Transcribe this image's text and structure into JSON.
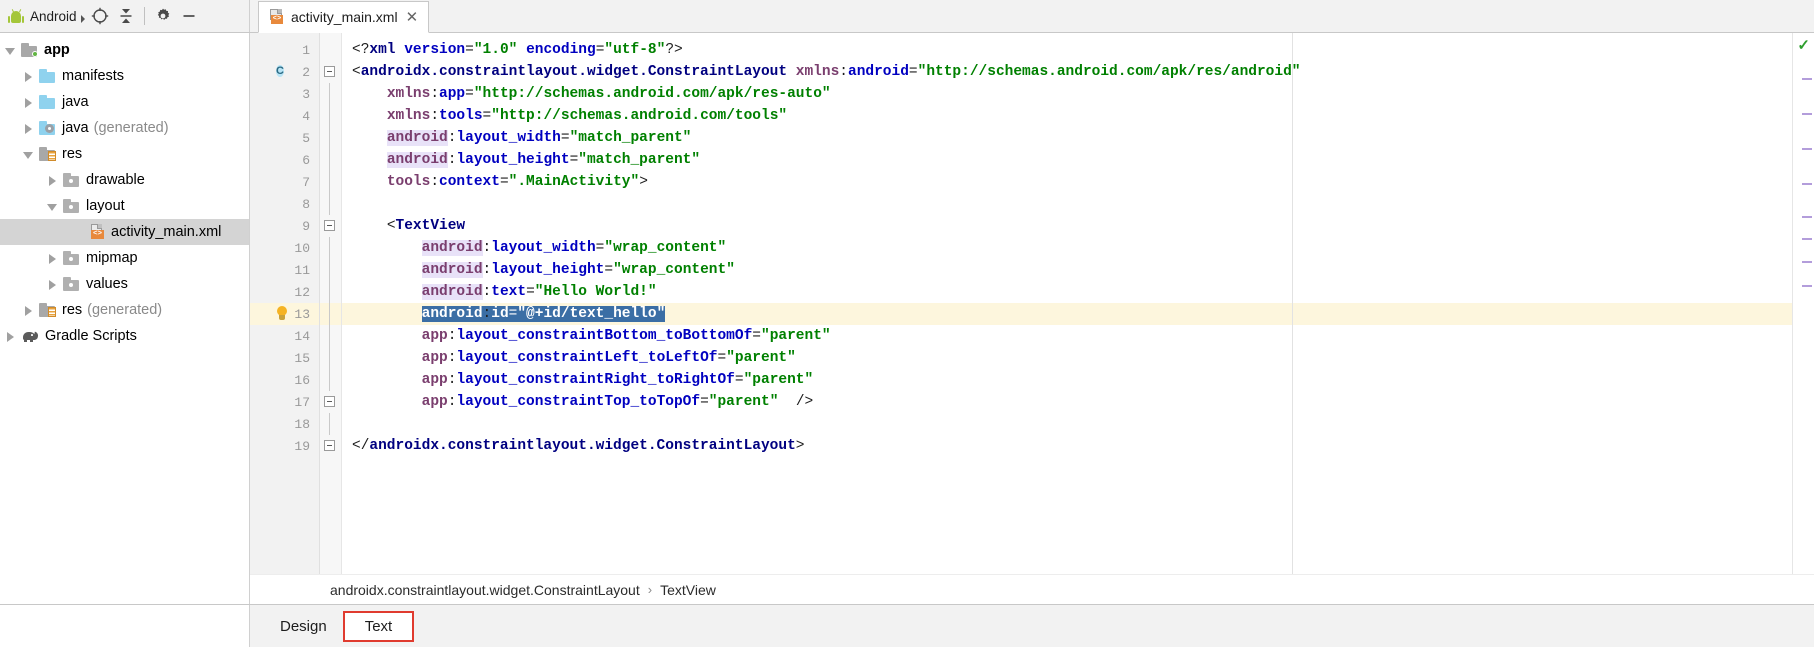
{
  "window": {
    "toolwindow_label": "Android",
    "toolbar_icons": [
      {
        "name": "locate-icon",
        "glyph": "target"
      },
      {
        "name": "collapse-all-icon",
        "glyph": "collapse"
      },
      {
        "name": "settings-gear-icon",
        "glyph": "gear"
      },
      {
        "name": "hide-icon",
        "glyph": "minus"
      }
    ]
  },
  "editor_tab": {
    "title": "activity_main.xml",
    "icon": "xml-layout-file-icon",
    "close_glyph": "✕"
  },
  "project_tree": [
    {
      "label": "app",
      "suffix": "",
      "depth": 0,
      "state": "open",
      "icon": "module-folder",
      "bold": true,
      "selected": false
    },
    {
      "label": "manifests",
      "suffix": "",
      "depth": 1,
      "state": "closed",
      "icon": "blue-folder",
      "bold": false,
      "selected": false
    },
    {
      "label": "java",
      "suffix": "",
      "depth": 1,
      "state": "closed",
      "icon": "blue-folder",
      "bold": false,
      "selected": false
    },
    {
      "label": "java",
      "suffix": "(generated)",
      "depth": 1,
      "state": "closed",
      "icon": "generated-folder",
      "bold": false,
      "selected": false
    },
    {
      "label": "res",
      "suffix": "",
      "depth": 1,
      "state": "open",
      "icon": "res-folder",
      "bold": false,
      "selected": false
    },
    {
      "label": "drawable",
      "suffix": "",
      "depth": 2,
      "state": "closed",
      "icon": "gray-folder",
      "bold": false,
      "selected": false
    },
    {
      "label": "layout",
      "suffix": "",
      "depth": 2,
      "state": "open",
      "icon": "gray-folder",
      "bold": false,
      "selected": false
    },
    {
      "label": "activity_main.xml",
      "suffix": "",
      "depth": 3,
      "state": "none",
      "icon": "xml-file",
      "bold": false,
      "selected": true
    },
    {
      "label": "mipmap",
      "suffix": "",
      "depth": 2,
      "state": "closed",
      "icon": "gray-folder",
      "bold": false,
      "selected": false
    },
    {
      "label": "values",
      "suffix": "",
      "depth": 2,
      "state": "closed",
      "icon": "gray-folder",
      "bold": false,
      "selected": false
    },
    {
      "label": "res",
      "suffix": "(generated)",
      "depth": 1,
      "state": "closed",
      "icon": "res-folder",
      "bold": false,
      "selected": false
    },
    {
      "label": "Gradle Scripts",
      "suffix": "",
      "depth": 0,
      "state": "closed",
      "icon": "gradle-elephant",
      "bold": false,
      "selected": false
    }
  ],
  "editor": {
    "line_numbers": [
      "1",
      "2",
      "3",
      "4",
      "5",
      "6",
      "7",
      "8",
      "9",
      "10",
      "11",
      "12",
      "13",
      "14",
      "15",
      "16",
      "17",
      "18",
      "19"
    ],
    "current_line": 13,
    "class_marker_line": 2,
    "class_marker_text": "C",
    "bulb_line": 13,
    "code_lines": [
      "<?xml version=\"1.0\" encoding=\"utf-8\"?>",
      "<androidx.constraintlayout.widget.ConstraintLayout xmlns:android=\"http://schemas.android.com/apk/res/android\"",
      "    xmlns:app=\"http://schemas.android.com/apk/res-auto\"",
      "    xmlns:tools=\"http://schemas.android.com/tools\"",
      "    android:layout_width=\"match_parent\"",
      "    android:layout_height=\"match_parent\"",
      "    tools:context=\".MainActivity\">",
      "",
      "    <TextView",
      "        android:layout_width=\"wrap_content\"",
      "        android:layout_height=\"wrap_content\"",
      "        android:text=\"Hello World!\"",
      "        android:id=\"@+id/text_hello\"",
      "        app:layout_constraintBottom_toBottomOf=\"parent\"",
      "        app:layout_constraintLeft_toLeftOf=\"parent\"",
      "        app:layout_constraintRight_toRightOf=\"parent\"",
      "        app:layout_constraintTop_toTopOf=\"parent\"  />",
      "",
      "</androidx.constraintlayout.widget.ConstraintLayout>"
    ],
    "selected_text": "android:id=\"@+id/text_hello\"",
    "status_ok_glyph": "✓",
    "colors": {
      "tag": "#000080",
      "attribute": "#0000c0",
      "namespace": "#7a3e6e",
      "value": "#008000",
      "namespace_highlight": "#e8e2f8",
      "selection": "#3b6ea5",
      "caret_line": "#fdf6dd",
      "ok_check": "#2e9e2e"
    }
  },
  "breadcrumb": {
    "items": [
      "androidx.constraintlayout.widget.ConstraintLayout",
      "TextView"
    ],
    "separator": "›"
  },
  "bottom_tabs": [
    {
      "label": "Design",
      "active": false,
      "highlighted": false
    },
    {
      "label": "Text",
      "active": true,
      "highlighted": true
    }
  ]
}
